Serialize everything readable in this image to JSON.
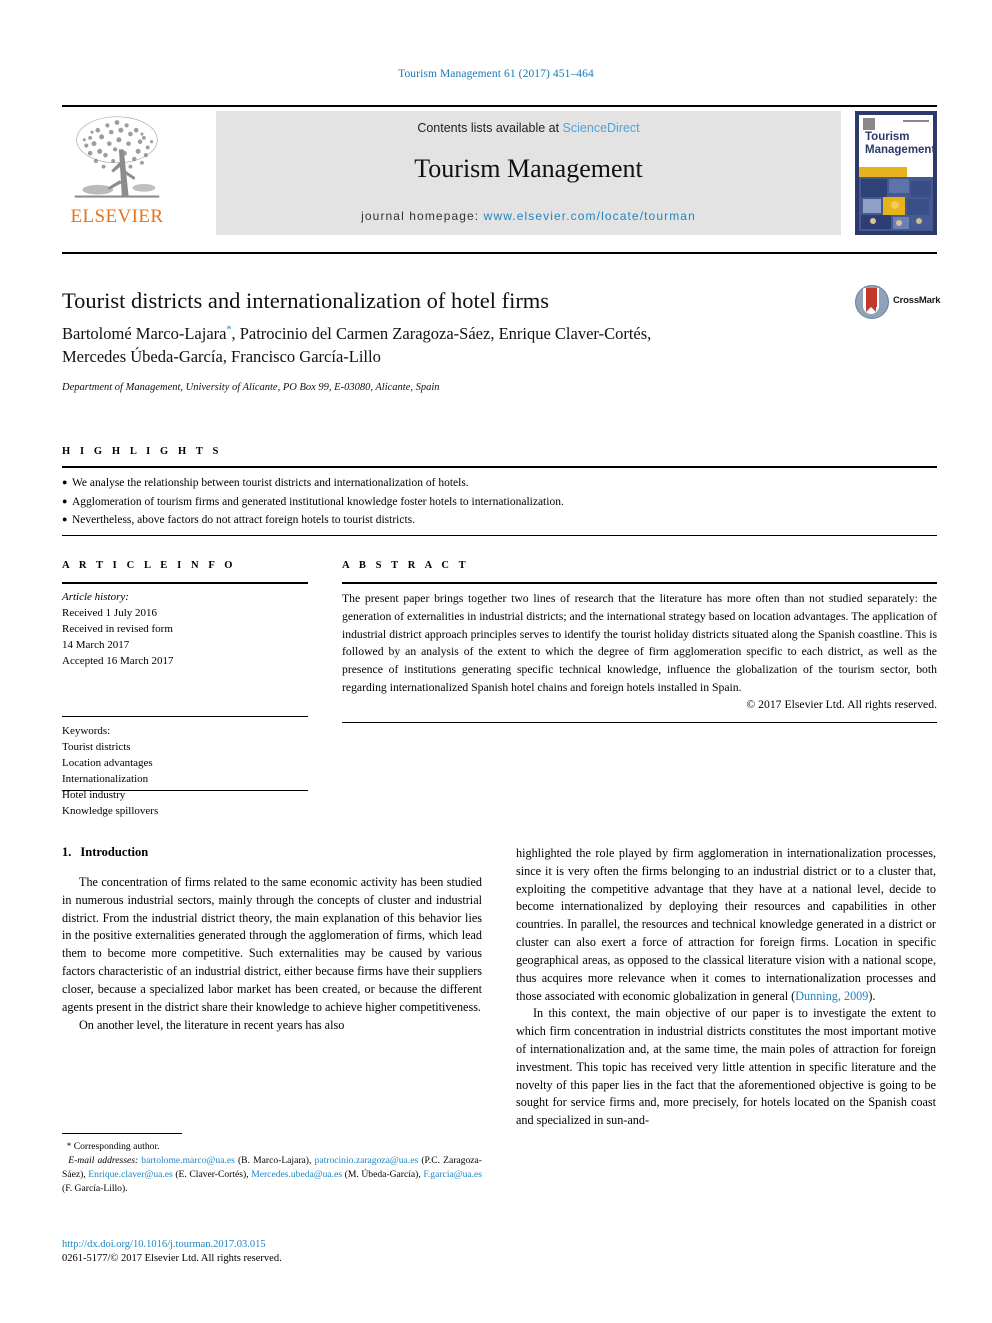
{
  "running_head": "Tourism Management 61 (2017) 451–464",
  "masthead": {
    "contents_prefix": "Contents lists available at ",
    "sciencedirect": "ScienceDirect",
    "journal_title": "Tourism Management",
    "homepage_label": "journal homepage: ",
    "homepage_url": "www.elsevier.com/locate/tourman",
    "publisher": "ELSEVIER",
    "cover_title": "Tourism Management",
    "colors": {
      "link_blue": "#1f86c0",
      "sciencedirect_blue": "#4ea3d8",
      "elsevier_orange": "#e8721c",
      "cover_navy": "#2b3a6b",
      "cover_yellow": "#e8b21c",
      "banner_gray": "#e3e3e3"
    }
  },
  "article": {
    "title": "Tourist districts and internationalization of hotel firms",
    "authors": "Bartolomé Marco-Lajara*, Patrocinio del Carmen Zaragoza-Sáez, Enrique Claver-Cortés, Mercedes Úbeda-García, Francisco García-Lillo",
    "authors_line1_a": "Bartolomé Marco-Lajara",
    "authors_line1_b": ", Patrocinio del Carmen Zaragoza-Sáez, Enrique Claver-Cortés,",
    "authors_line2": "Mercedes Úbeda-García, Francisco García-Lillo",
    "corresponding_marker": "*",
    "affiliation": "Department of Management, University of Alicante, PO Box 99, E-03080, Alicante, Spain",
    "crossmark_label": "CrossMark"
  },
  "highlights": {
    "heading": "H I G H L I G H T S",
    "items": [
      "We analyse the relationship between tourist districts and internationalization of hotels.",
      "Agglomeration of tourism firms and generated institutional knowledge foster hotels to internationalization.",
      "Nevertheless, above factors do not attract foreign hotels to tourist districts."
    ]
  },
  "article_info": {
    "heading": "A R T I C L E   I N F O",
    "history_label": "Article history:",
    "history": [
      "Received 1 July 2016",
      "Received in revised form",
      "14 March 2017",
      "Accepted 16 March 2017"
    ],
    "keywords_label": "Keywords:",
    "keywords": [
      "Tourist districts",
      "Location advantages",
      "Internationalization",
      "Hotel industry",
      "Knowledge spillovers"
    ]
  },
  "abstract": {
    "heading": "A B S T R A C T",
    "text": "The present paper brings together two lines of research that the literature has more often than not studied separately: the generation of externalities in industrial districts; and the international strategy based on location advantages. The application of industrial district approach principles serves to identify the tourist holiday districts situated along the Spanish coastline. This is followed by an analysis of the extent to which the degree of firm agglomeration specific to each district, as well as the presence of institutions generating specific technical knowledge, influence the globalization of the tourism sector, both regarding internationalized Spanish hotel chains and foreign hotels installed in Spain.",
    "copyright": "© 2017 Elsevier Ltd. All rights reserved."
  },
  "body": {
    "section_number": "1.",
    "section_title": "Introduction",
    "left_paragraphs": [
      "The concentration of firms related to the same economic activity has been studied in numerous industrial sectors, mainly through the concepts of cluster and industrial district. From the industrial district theory, the main explanation of this behavior lies in the positive externalities generated through the agglomeration of firms, which lead them to become more competitive. Such externalities may be caused by various factors characteristic of an industrial district, either because firms have their suppliers closer, because a specialized labor market has been created, or because the different agents present in the district share their knowledge to achieve higher competitiveness.",
      "On another level, the literature in recent years has also"
    ],
    "right_paragraph_1_a": "highlighted the role played by firm agglomeration in internationalization processes, since it is very often the firms belonging to an industrial district or to a cluster that, exploiting the competitive advantage that they have at a national level, decide to become internationalized by deploying their resources and capabilities in other countries. In parallel, the resources and technical knowledge generated in a district or cluster can also exert a force of attraction for foreign firms. Location in specific geographical areas, as opposed to the classical literature vision with a national scope, thus acquires more relevance when it comes to internationalization processes and those associated with economic globalization in general (",
    "right_paragraph_1_cite": "Dunning, 2009",
    "right_paragraph_1_b": ").",
    "right_paragraph_2": "In this context, the main objective of our paper is to investigate the extent to which firm concentration in industrial districts constitutes the most important motive of internationalization and, at the same time, the main poles of attraction for foreign investment. This topic has received very little attention in specific literature and the novelty of this paper lies in the fact that the aforementioned objective is going to be sought for service firms and, more precisely, for hotels located on the Spanish coast and specialized in sun-and-"
  },
  "footnote": {
    "corresponding": "Corresponding author.",
    "email_label": "E-mail addresses:",
    "emails": [
      {
        "address": "bartolome.marco@ua.es",
        "name": "(B. Marco-Lajara)"
      },
      {
        "address": "patrocinio.zaragoza@ua.es",
        "name": "(P.C. Zaragoza-Sáez)"
      },
      {
        "address": "Enrique.claver@ua.es",
        "name": "(E. Claver-Cortés)"
      },
      {
        "address": "Mercedes.ubeda@ua.es",
        "name": "(M. Úbeda-García)"
      },
      {
        "address": "F.garcia@ua.es",
        "name": "(F. García-Lillo)"
      }
    ],
    "doi": "http://dx.doi.org/10.1016/j.tourman.2017.03.015",
    "issn": "0261-5177/© 2017 Elsevier Ltd. All rights reserved."
  }
}
